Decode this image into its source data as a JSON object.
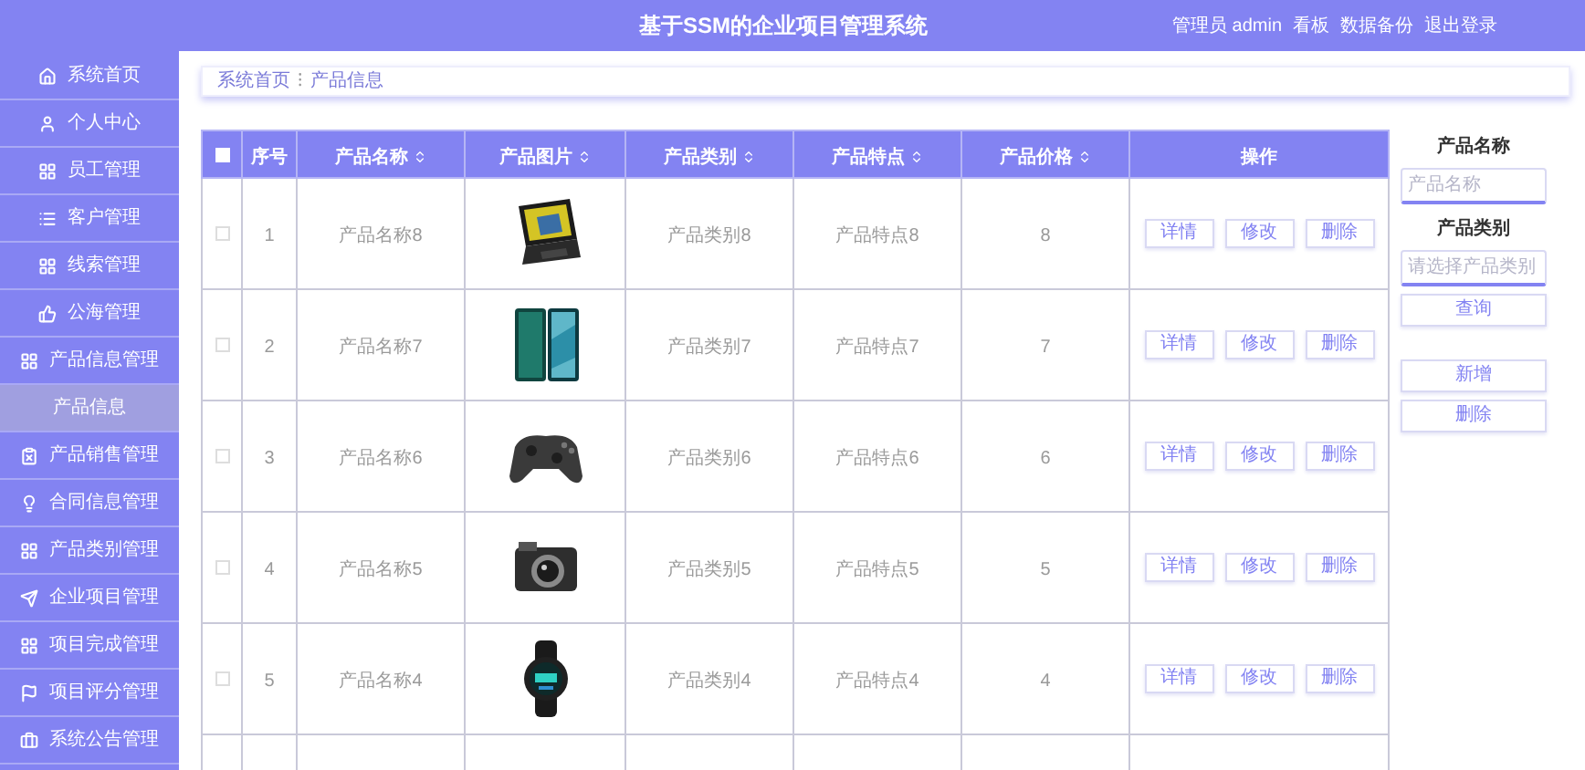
{
  "header": {
    "title": "基于SSM的企业项目管理系统",
    "links": [
      "管理员 admin",
      "看板",
      "数据备份",
      "退出登录"
    ]
  },
  "sidebar": {
    "items": [
      {
        "label": "系统首页",
        "selected": false
      },
      {
        "label": "个人中心",
        "selected": false
      },
      {
        "label": "员工管理",
        "selected": false
      },
      {
        "label": "客户管理",
        "selected": false
      },
      {
        "label": "线索管理",
        "selected": false
      },
      {
        "label": "公海管理",
        "selected": false
      },
      {
        "label": "产品信息管理",
        "selected": false,
        "children": [
          {
            "label": "产品信息",
            "selected": true
          }
        ]
      },
      {
        "label": "产品销售管理",
        "selected": false
      },
      {
        "label": "合同信息管理",
        "selected": false
      },
      {
        "label": "产品类别管理",
        "selected": false
      },
      {
        "label": "企业项目管理",
        "selected": false
      },
      {
        "label": "项目完成管理",
        "selected": false
      },
      {
        "label": "项目评分管理",
        "selected": false
      },
      {
        "label": "系统公告管理",
        "selected": false
      }
    ]
  },
  "breadcrumb": {
    "items": [
      "系统首页",
      "产品信息"
    ],
    "separator": "⁝"
  },
  "table": {
    "select_all": {
      "checked": false
    },
    "columns": [
      {
        "label": "序号",
        "sortable": false
      },
      {
        "label": "产品名称",
        "sortable": true
      },
      {
        "label": "产品图片",
        "sortable": true
      },
      {
        "label": "产品类别",
        "sortable": true
      },
      {
        "label": "产品特点",
        "sortable": true
      },
      {
        "label": "产品价格",
        "sortable": true
      },
      {
        "label": "操作",
        "sortable": false
      }
    ],
    "rows": [
      {
        "checked": false,
        "no": "1",
        "name": "产品名称8",
        "category": "产品类别8",
        "feature": "产品特点8",
        "price": "8",
        "actions": [
          "详情",
          "修改",
          "删除"
        ]
      },
      {
        "checked": false,
        "no": "2",
        "name": "产品名称7",
        "category": "产品类别7",
        "feature": "产品特点7",
        "price": "7",
        "actions": [
          "详情",
          "修改",
          "删除"
        ]
      },
      {
        "checked": false,
        "no": "3",
        "name": "产品名称6",
        "category": "产品类别6",
        "feature": "产品特点6",
        "price": "6",
        "actions": [
          "详情",
          "修改",
          "删除"
        ]
      },
      {
        "checked": false,
        "no": "4",
        "name": "产品名称5",
        "category": "产品类别5",
        "feature": "产品特点5",
        "price": "5",
        "actions": [
          "详情",
          "修改",
          "删除"
        ]
      },
      {
        "checked": false,
        "no": "5",
        "name": "产品名称4",
        "category": "产品类别4",
        "feature": "产品特点4",
        "price": "4",
        "actions": [
          "详情",
          "修改",
          "删除"
        ]
      }
    ]
  },
  "search": {
    "fields": [
      {
        "label": "产品名称",
        "placeholder": "产品名称"
      },
      {
        "label": "产品类别",
        "placeholder": "请选择产品类别"
      }
    ],
    "buttons": [
      "查询",
      "新增",
      "删除"
    ]
  }
}
